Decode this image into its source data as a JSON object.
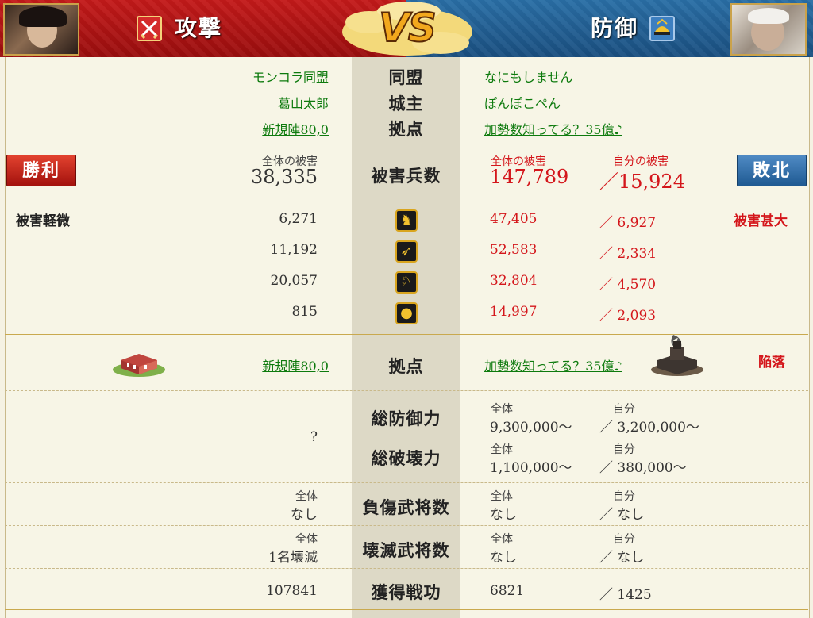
{
  "header": {
    "attack_title": "攻撃",
    "defense_title": "防御",
    "vs": "VS"
  },
  "info": {
    "alliance_label": "同盟",
    "lord_label": "城主",
    "base_label": "拠点",
    "attacker": {
      "alliance": "モンコラ同盟",
      "lord": "葛山太郎",
      "base": "新規陣80,0"
    },
    "defender": {
      "alliance": "なにもしません",
      "lord": "ぽんぽこぺん",
      "base": "加勢数知ってる？35億♪"
    }
  },
  "casualties": {
    "label": "被害兵数",
    "attacker_result": "勝利",
    "defender_result": "敗北",
    "attacker_total_label": "全体の被害",
    "attacker_total": "38,335",
    "defender_total_label": "全体の被害",
    "defender_total": "147,789",
    "defender_own_label": "自分の被害",
    "defender_own": "／15,924",
    "attacker_status": "被害軽微",
    "defender_status": "被害甚大",
    "units": [
      {
        "icon": "spearman-icon",
        "attacker": "6,271",
        "defender_total": "47,405",
        "defender_own": "／ 6,927"
      },
      {
        "icon": "archer-icon",
        "attacker": "11,192",
        "defender_total": "52,583",
        "defender_own": "／ 2,334"
      },
      {
        "icon": "cavalry-icon",
        "attacker": "20,057",
        "defender_total": "32,804",
        "defender_own": "／ 4,570"
      },
      {
        "icon": "siege-icon",
        "attacker": "815",
        "defender_total": "14,997",
        "defender_own": "／ 2,093"
      }
    ]
  },
  "base_result": {
    "label": "拠点",
    "attacker_base": "新規陣80,0",
    "defender_base": "加勢数知ってる？35億♪",
    "defender_status": "陥落"
  },
  "power": {
    "defense_label": "総防御力",
    "destroy_label": "総破壊力",
    "attacker_value": "?",
    "all_label": "全体",
    "own_label": "自分",
    "defense_total": "9,300,000～",
    "defense_own": "／ 3,200,000～",
    "destroy_total": "1,100,000～",
    "destroy_own": "／ 380,000～"
  },
  "injured": {
    "label": "負傷武将数",
    "all_label": "全体",
    "own_label": "自分",
    "attacker": "なし",
    "defender_total": "なし",
    "defender_own": "／ なし"
  },
  "destroyed": {
    "label": "壊滅武将数",
    "all_label": "全体",
    "own_label": "自分",
    "attacker": "1名壊滅",
    "defender_total": "なし",
    "defender_own": "／ なし"
  },
  "merit": {
    "label": "獲得戦功",
    "attacker": "107841",
    "defender_total": "6821",
    "defender_own": "／ 1425"
  }
}
